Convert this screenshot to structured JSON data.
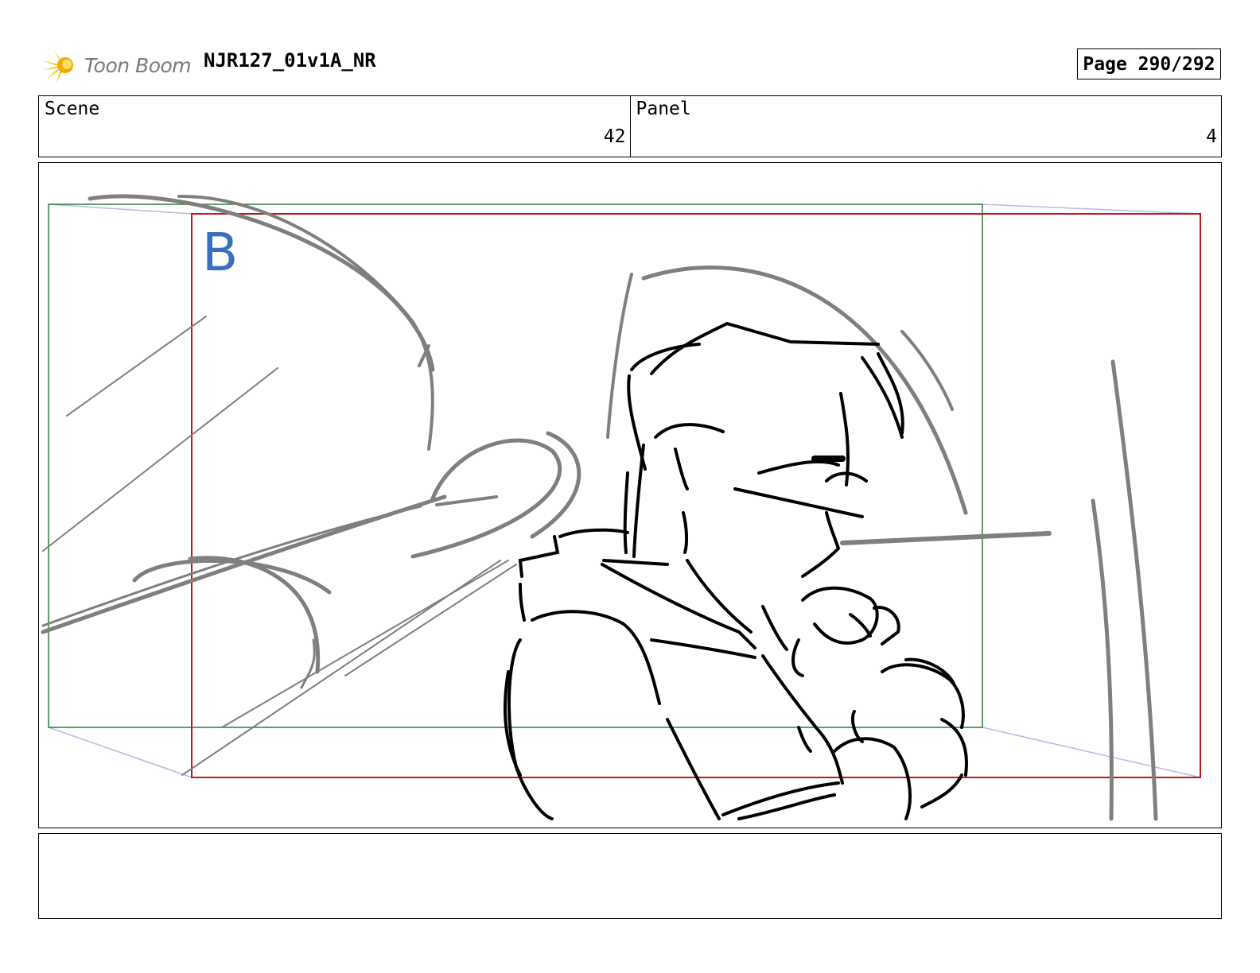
{
  "header": {
    "logo_text": "Toon Boom",
    "doc_title": "NJR127_01v1A_NR",
    "page_label": "Page 290/292"
  },
  "scene": {
    "label": "Scene",
    "value": "42"
  },
  "panel": {
    "label": "Panel",
    "value": "4"
  },
  "drawing": {
    "overlay_label": "B",
    "colors": {
      "frame_green": "#2e7d32",
      "frame_red": "#b71c1c",
      "sketch_gray": "#7f7f7f",
      "ink": "#000000",
      "label_blue": "#3a6fc0"
    }
  },
  "notes": {
    "text": ""
  }
}
